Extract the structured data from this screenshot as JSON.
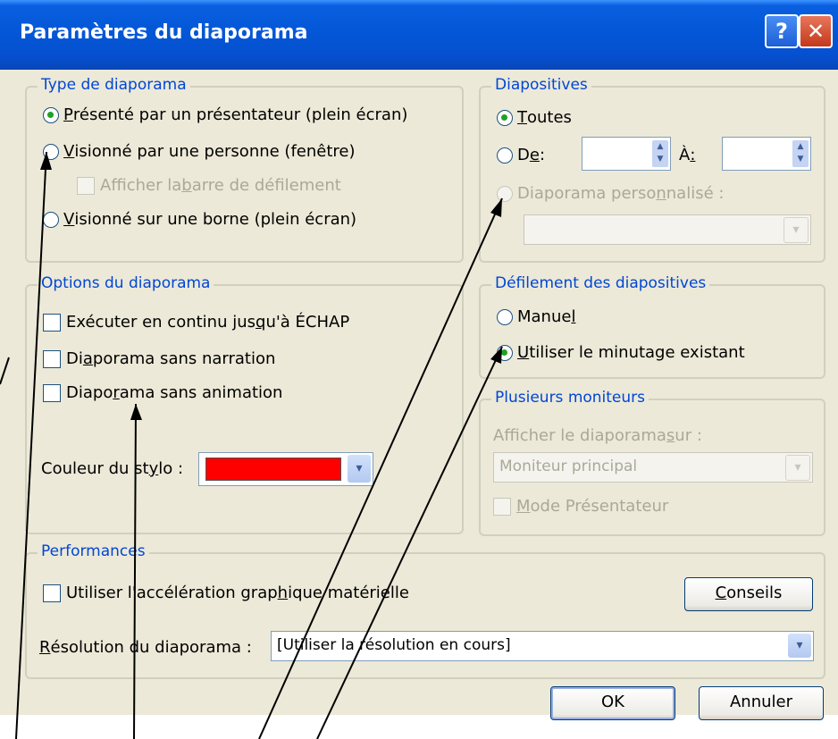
{
  "window": {
    "title": "Paramètres du diaporama"
  },
  "type_group": {
    "title": "Type de diaporama",
    "opt_presented_pre": "",
    "opt_presented_u": "P",
    "opt_presented_post": "résenté par un présentateur (plein écran)",
    "opt_browsed_pre": "",
    "opt_browsed_u": "V",
    "opt_browsed_post": "isionné par une personne (fenêtre)",
    "scrollbar_pre": "Afficher la ",
    "scrollbar_u": "b",
    "scrollbar_post": "arre de défilement",
    "opt_kiosk_pre": "",
    "opt_kiosk_u": "V",
    "opt_kiosk_post": "isionné sur une borne (plein écran)"
  },
  "slides_group": {
    "title": "Diapositives",
    "all_pre": "",
    "all_u": "T",
    "all_post": "outes",
    "from_pre": "D",
    "from_u": "e",
    "from_post": " :",
    "to_pre": "À ",
    "to_u": ":",
    "to_post": "",
    "custom_pre": "Diaporama perso",
    "custom_u": "n",
    "custom_post": "nalisé :"
  },
  "options_group": {
    "title": "Options du diaporama",
    "loop_pre": "Exécuter en continu jus",
    "loop_u": "q",
    "loop_post": "u'à ÉCHAP",
    "nonarr_pre": "Di",
    "nonarr_u": "a",
    "nonarr_post": "porama sans narration",
    "noanim_pre": "Diapo",
    "noanim_u": "r",
    "noanim_post": "ama sans animation",
    "pen_pre": "Couleur du st",
    "pen_u": "y",
    "pen_post": "lo :"
  },
  "advance_group": {
    "title": "Défilement des diapositives",
    "manual_pre": "Manue",
    "manual_u": "l",
    "manual_post": "",
    "timings_pre": "",
    "timings_u": "U",
    "timings_post": "tiliser le minutage existant"
  },
  "monitors_group": {
    "title": "Plusieurs moniteurs",
    "show_on_pre": "Afficher le diaporama ",
    "show_on_u": "s",
    "show_on_post": "ur :",
    "monitor_value": "Moniteur principal",
    "presenter_pre": "",
    "presenter_u": "M",
    "presenter_post": "ode Présentateur"
  },
  "perf_group": {
    "title": "Performances",
    "hw_pre": "Utiliser l'accélération grap",
    "hw_u": "h",
    "hw_post": "ique matérielle",
    "tips_pre": "",
    "tips_u": "C",
    "tips_post": "onseils",
    "res_pre": "",
    "res_u": "R",
    "res_post": "ésolution du diaporama :",
    "res_value": "[Utiliser la résolution en cours]"
  },
  "buttons": {
    "ok": "OK",
    "cancel": "Annuler"
  },
  "colors": {
    "pen_color": "#ff0000",
    "group_title": "#0046d5",
    "titlebar": "#0458d8"
  },
  "icons": {
    "help": "help-icon",
    "close": "close-icon",
    "dropdown": "chevron-down-icon"
  }
}
